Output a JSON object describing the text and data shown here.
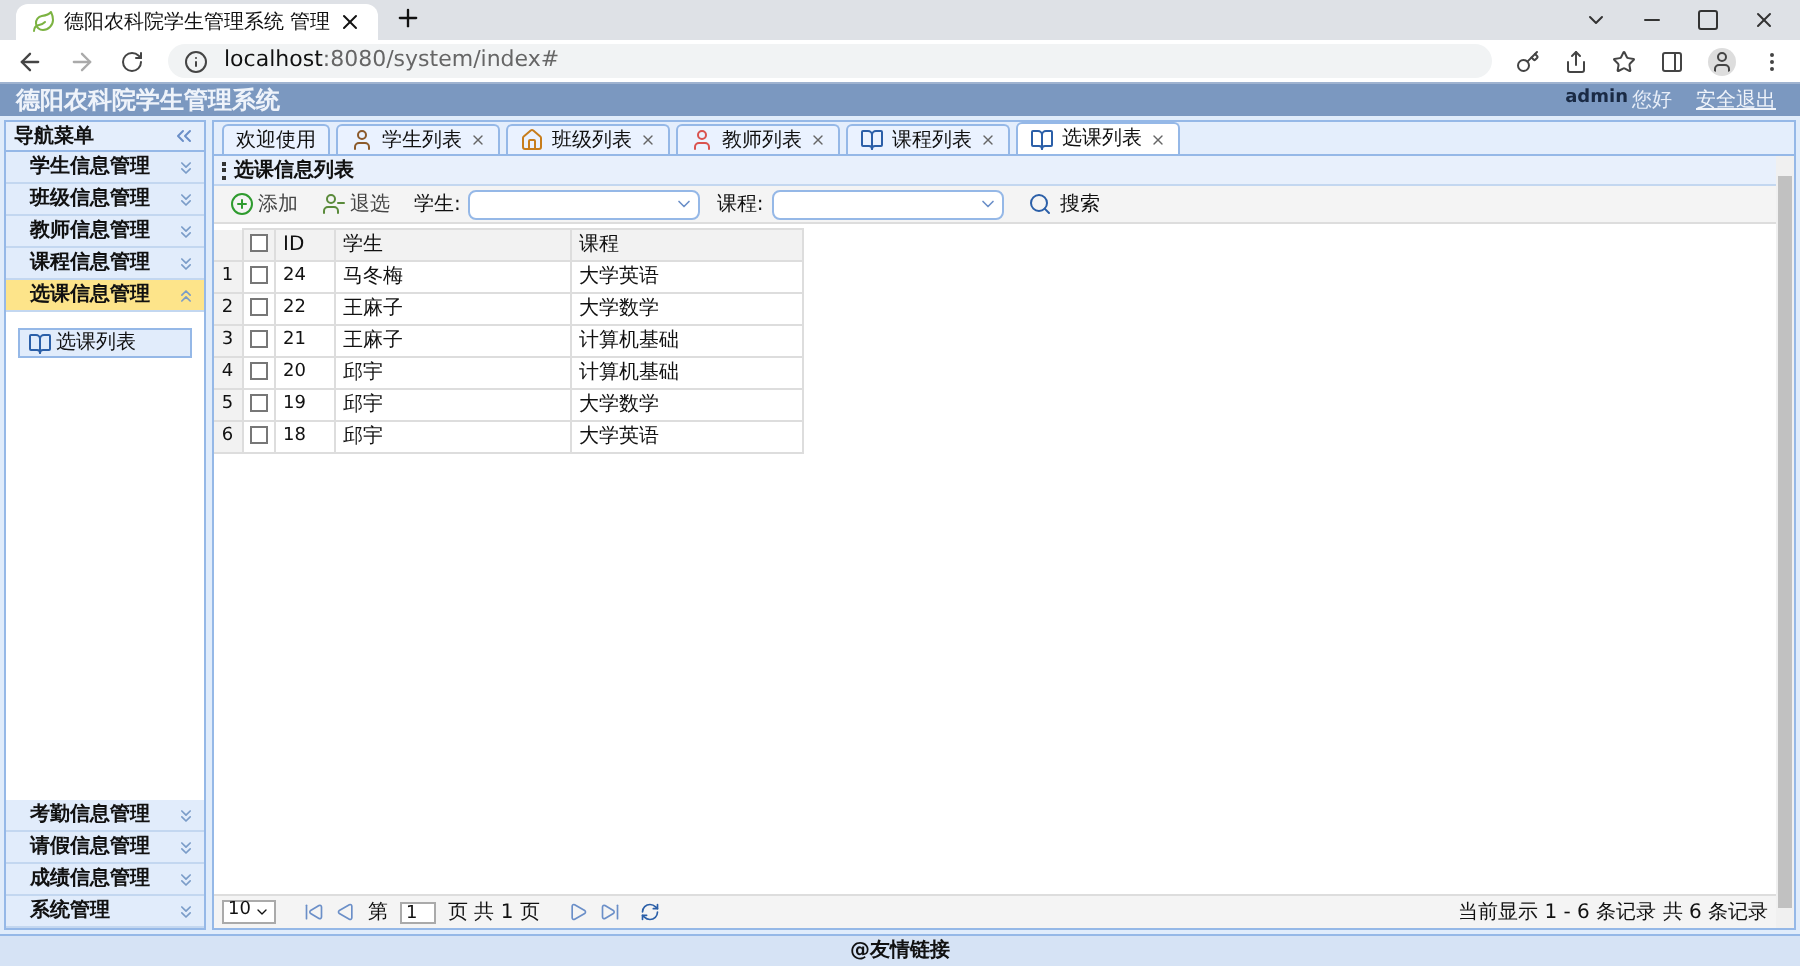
{
  "browser": {
    "tab_title": "德阳农科院学生管理系统 管理",
    "url_host": "localhost",
    "url_rest": ":8080/system/index#"
  },
  "header": {
    "title": "德阳农科院学生管理系统",
    "user": "admin",
    "greeting": "您好",
    "logout": "安全退出"
  },
  "sidebar": {
    "title": "导航菜单",
    "items": [
      {
        "label": "学生信息管理",
        "expanded": false
      },
      {
        "label": "班级信息管理",
        "expanded": false
      },
      {
        "label": "教师信息管理",
        "expanded": false
      },
      {
        "label": "课程信息管理",
        "expanded": false
      },
      {
        "label": "选课信息管理",
        "expanded": true,
        "children": [
          {
            "label": "选课列表"
          }
        ]
      },
      {
        "label": "考勤信息管理",
        "expanded": false
      },
      {
        "label": "请假信息管理",
        "expanded": false
      },
      {
        "label": "成绩信息管理",
        "expanded": false
      },
      {
        "label": "系统管理",
        "expanded": false
      }
    ]
  },
  "tabs": [
    {
      "label": "欢迎使用",
      "kind": "plain",
      "selected": false
    },
    {
      "label": "学生列表",
      "kind": "person",
      "selected": false
    },
    {
      "label": "班级列表",
      "kind": "house",
      "selected": false
    },
    {
      "label": "教师列表",
      "kind": "teacher",
      "selected": false
    },
    {
      "label": "课程列表",
      "kind": "book",
      "selected": false
    },
    {
      "label": "选课列表",
      "kind": "book",
      "selected": true
    }
  ],
  "panel": {
    "title": "选课信息列表",
    "toolbar": [
      {
        "label": "添加",
        "kind": "add"
      },
      {
        "label": "退选",
        "kind": "remove"
      }
    ],
    "filters": [
      {
        "label": "学生:"
      },
      {
        "label": "课程:"
      }
    ],
    "search": "搜索"
  },
  "table": {
    "all_checked": false,
    "columns": [
      "ID",
      "学生",
      "课程"
    ],
    "rows": [
      {
        "index": "1",
        "checked": false,
        "id": "24",
        "student": "马冬梅",
        "course": "大学英语"
      },
      {
        "index": "2",
        "checked": false,
        "id": "22",
        "student": "王麻子",
        "course": "大学数学"
      },
      {
        "index": "3",
        "checked": false,
        "id": "21",
        "student": "王麻子",
        "course": "计算机基础"
      },
      {
        "index": "4",
        "checked": false,
        "id": "20",
        "student": "邱宇",
        "course": "计算机基础"
      },
      {
        "index": "5",
        "checked": false,
        "id": "19",
        "student": "邱宇",
        "course": "大学数学"
      },
      {
        "index": "6",
        "checked": false,
        "id": "18",
        "student": "邱宇",
        "course": "大学英语"
      }
    ]
  },
  "pager": {
    "page_size": "10",
    "before": "第",
    "page": "1",
    "after": "页 共 1 页",
    "summary": "当前显示 1 - 6 条记录 共 6 条记录"
  },
  "footer": "@友情链接"
}
